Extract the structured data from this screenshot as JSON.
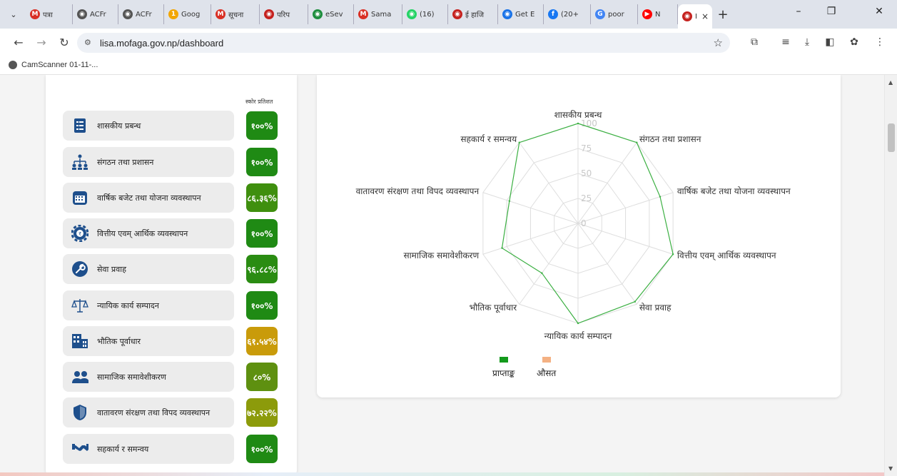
{
  "browser": {
    "tabs": [
      {
        "label": "पत्रा",
        "fav": "M",
        "color": "#d93025"
      },
      {
        "label": "ACFr",
        "fav": "◉",
        "color": "#555555"
      },
      {
        "label": "ACFr",
        "fav": "◉",
        "color": "#555555"
      },
      {
        "label": "Goog",
        "fav": "1",
        "color": "#f2a600"
      },
      {
        "label": "सूचना",
        "fav": "M",
        "color": "#d93025"
      },
      {
        "label": "परिप",
        "fav": "◉",
        "color": "#c5221f"
      },
      {
        "label": "eSev",
        "fav": "◉",
        "color": "#1e8e3e"
      },
      {
        "label": "Sama",
        "fav": "M",
        "color": "#d93025"
      },
      {
        "label": "(16)",
        "fav": "◉",
        "color": "#25d366"
      },
      {
        "label": "ई हाजि",
        "fav": "◉",
        "color": "#c5221f"
      },
      {
        "label": "Get E",
        "fav": "◉",
        "color": "#1a73e8"
      },
      {
        "label": "(20+",
        "fav": "f",
        "color": "#1877f2"
      },
      {
        "label": "poor",
        "fav": "G",
        "color": "#4285f4"
      },
      {
        "label": "N",
        "fav": "▶",
        "color": "#ff0000"
      }
    ],
    "active_tab": {
      "label": "I",
      "fav": "◉",
      "color": "#c5221f"
    },
    "url": "lisa.mofaga.gov.np/dashboard",
    "bookmark": "CamScanner 01-11-..."
  },
  "left_panel": {
    "score_heading": "स्कोर प्रतिशत",
    "items": [
      {
        "label": "शासकीय प्रबन्ध",
        "score": "१००%",
        "color": "#1f8a14",
        "icon": "document-list-icon"
      },
      {
        "label": "संगठन तथा प्रशासन",
        "score": "१००%",
        "color": "#1f8a14",
        "icon": "org-chart-icon"
      },
      {
        "label": "वार्षिक बजेट तथा योजना व्यवस्थापन",
        "score": "८६.३६%",
        "color": "#3f8f0e",
        "icon": "calendar-icon"
      },
      {
        "label": "वित्तीय एवम् आर्थिक व्यवस्थापन",
        "score": "१००%",
        "color": "#1f8a14",
        "icon": "finance-gear-icon"
      },
      {
        "label": "सेवा प्रवाह",
        "score": "९६.८८%",
        "color": "#2a8c12",
        "icon": "service-wrench-icon"
      },
      {
        "label": "न्यायिक कार्य सम्पादन",
        "score": "१००%",
        "color": "#1f8a14",
        "icon": "justice-scale-icon"
      },
      {
        "label": "भौतिक पूर्वाधार",
        "score": "६१.५४%",
        "color": "#c99b0a",
        "icon": "building-icon"
      },
      {
        "label": "सामाजिक समावेशीकरण",
        "score": "८०%",
        "color": "#5e9010",
        "icon": "people-icon"
      },
      {
        "label": "वातावरण संरक्षण तथा विपद व्यवस्थापन",
        "score": "७२.२२%",
        "color": "#8c9b0b",
        "icon": "shield-icon"
      },
      {
        "label": "सहकार्य र समन्वय",
        "score": "१००%",
        "color": "#1f8a14",
        "icon": "handshake-icon"
      }
    ]
  },
  "chart_data": {
    "type": "radar",
    "axes": [
      "शासकीय प्रबन्ध",
      "संगठन तथा प्रशासन",
      "वार्षिक बजेट तथा योजना व्यवस्थापन",
      "वित्तीय एवम् आर्थिक व्यवस्थापन",
      "सेवा प्रवाह",
      "न्यायिक कार्य सम्पादन",
      "भौतिक पूर्वाधार",
      "सामाजिक समावेशीकरण",
      "वातावरण संरक्षण तथा विपद व्यवस्थापन",
      "सहकार्य र समन्वय"
    ],
    "ticks": [
      "0",
      "25",
      "50",
      "75",
      "100"
    ],
    "range": [
      0,
      100
    ],
    "series": [
      {
        "name": "प्राप्ताङ्क",
        "color": "#3cb043",
        "values": [
          100,
          100,
          86.36,
          100,
          96.88,
          100,
          61.54,
          80,
          72.22,
          100
        ]
      },
      {
        "name": "औसत",
        "color": "#f4b183",
        "values": []
      }
    ],
    "legend": "bottom"
  }
}
